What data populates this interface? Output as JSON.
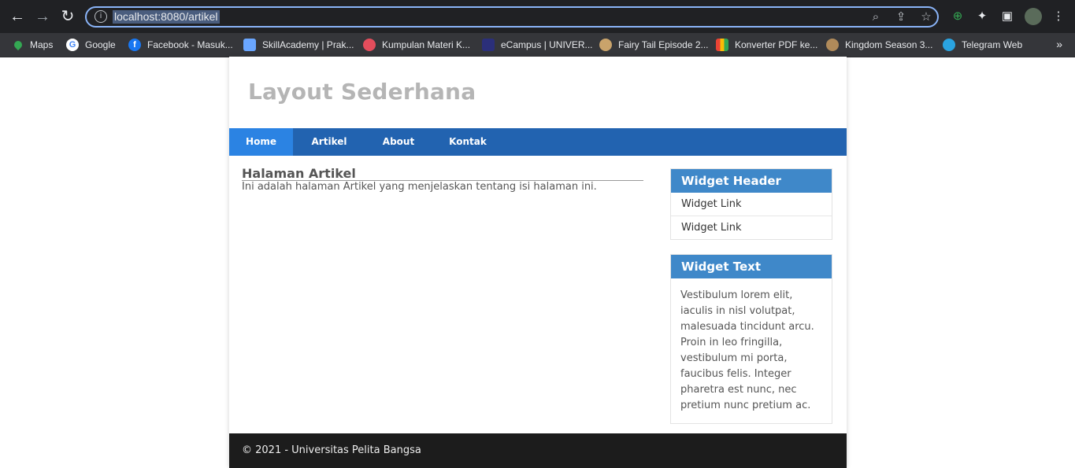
{
  "browser": {
    "url": "localhost:8080/artikel",
    "bookmarks": [
      {
        "label": "Maps",
        "color": "#34a853"
      },
      {
        "label": "Google",
        "color": "#ffffff"
      },
      {
        "label": "Facebook - Masuk...",
        "color": "#1877f2"
      },
      {
        "label": "SkillAcademy | Prak...",
        "color": "#6aa6ff"
      },
      {
        "label": "Kumpulan Materi K...",
        "color": "#e44d5c"
      },
      {
        "label": "eCampus | UNIVER...",
        "color": "#2b2f7a"
      },
      {
        "label": "Fairy Tail Episode 2...",
        "color": "#c9a36b"
      },
      {
        "label": "Konverter PDF ke...",
        "color": "#f4b400"
      },
      {
        "label": "Kingdom Season 3...",
        "color": "#b08a5a"
      },
      {
        "label": "Telegram Web",
        "color": "#2aa3e0"
      }
    ],
    "more": "»"
  },
  "site": {
    "title": "Layout Sederhana",
    "nav": [
      {
        "label": "Home",
        "active": true
      },
      {
        "label": "Artikel",
        "active": false
      },
      {
        "label": "About",
        "active": false
      },
      {
        "label": "Kontak",
        "active": false
      }
    ]
  },
  "content": {
    "heading": "Halaman Artikel",
    "text": "Ini adalah halaman Artikel yang menjelaskan tentang isi halaman ini."
  },
  "sidebar": {
    "widget1": {
      "header": "Widget Header",
      "links": [
        "Widget Link",
        "Widget Link"
      ]
    },
    "widget2": {
      "header": "Widget Text",
      "text": "Vestibulum lorem elit, iaculis in nisl volutpat, malesuada tincidunt arcu. Proin in leo fringilla, vestibulum mi porta, faucibus felis. Integer pharetra est nunc, nec pretium nunc pretium ac."
    }
  },
  "footer": {
    "text": "© 2021 - Universitas Pelita Bangsa"
  }
}
